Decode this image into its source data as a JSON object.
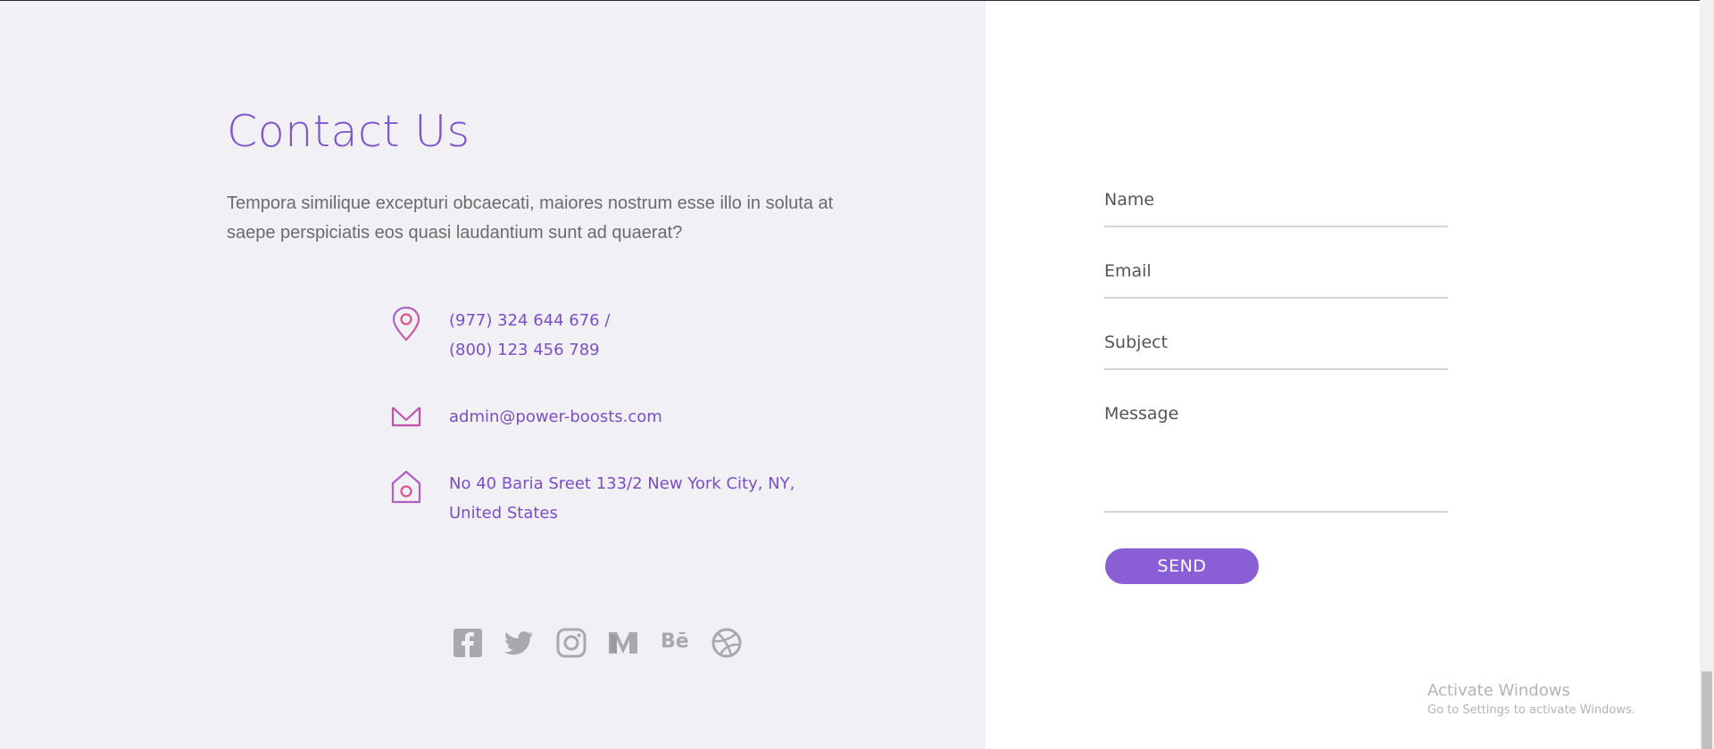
{
  "contact": {
    "title": "Contact Us",
    "intro": "Tempora similique excepturi obcaecati, maiores nostrum esse illo in soluta at saepe perspiciatis eos quasi laudantium sunt ad quaerat?",
    "phone_line1": "(977) 324 644 676 /",
    "phone_line2": "(800) 123 456 789",
    "email": "admin@power-boosts.com",
    "address_line1": "No 40 Baria Sreet 133/2 New York City, NY,",
    "address_line2": "United States",
    "icons": [
      "location-pin-icon",
      "envelope-icon",
      "home-icon"
    ],
    "accent_color": "#7f56c9",
    "icon_color": "#e0508c"
  },
  "socials": [
    "facebook-icon",
    "twitter-icon",
    "instagram-icon",
    "medium-icon",
    "behance-icon",
    "dribbble-icon"
  ],
  "form": {
    "name_placeholder": "Name",
    "email_placeholder": "Email",
    "subject_placeholder": "Subject",
    "message_placeholder": "Message",
    "send_label": "SEND",
    "button_color": "#8a5fd6"
  },
  "windows": {
    "line1": "Activate Windows",
    "line2": "Go to Settings to activate Windows."
  }
}
